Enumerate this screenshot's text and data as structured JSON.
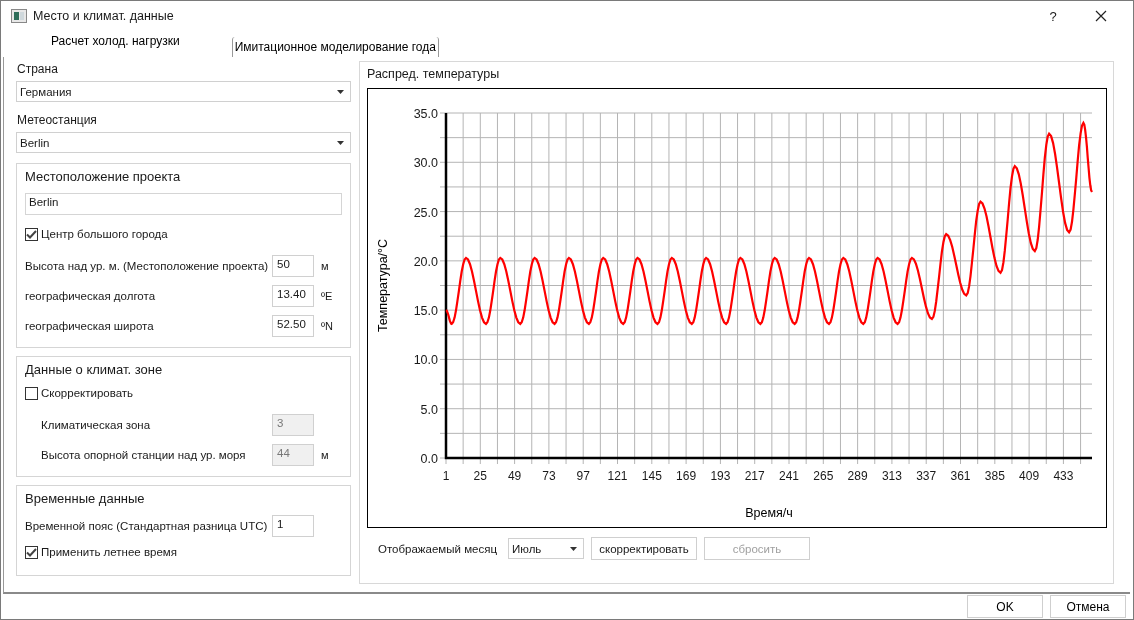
{
  "window": {
    "title": "Место и климат. данные",
    "help": "?"
  },
  "tabs": [
    {
      "label": "Расчет холод. нагрузки",
      "selected": true
    },
    {
      "label": "Имитационное моделирование года",
      "selected": false
    }
  ],
  "country": {
    "label": "Страна",
    "value": "Германия"
  },
  "station": {
    "label": "Метеостанция",
    "value": "Berlin"
  },
  "project_location": {
    "title": "Местоположение проекта",
    "name": "Berlin",
    "big_city": {
      "label": "Центр большого города",
      "checked": true
    },
    "fields": [
      {
        "label": "Высота над ур. м. (Местоположение проекта)",
        "value": "50",
        "unit": "м",
        "disabled": false
      },
      {
        "label": "географическая долгота",
        "value": "13.40",
        "unit": "ºE",
        "disabled": false
      },
      {
        "label": "географическая широта",
        "value": "52.50",
        "unit": "ºN",
        "disabled": false
      }
    ]
  },
  "climate_zone": {
    "title": "Данные о климат. зоне",
    "adjust": {
      "label": "Скорректировать",
      "checked": false
    },
    "fields": [
      {
        "label": "Климатическая зона",
        "value": "3",
        "disabled": true
      },
      {
        "label": "Высота опорной станции над ур. моря",
        "value": "44",
        "unit": "м",
        "disabled": true
      }
    ]
  },
  "time_data": {
    "title": "Временные данные",
    "fields": [
      {
        "label": "Временной пояс (Стандартная разница UTC)",
        "value": "1",
        "disabled": false
      }
    ],
    "dst": {
      "label": "Применить летнее время",
      "checked": true
    }
  },
  "chart_panel": {
    "title": "Распред. температуры",
    "chart_data": {
      "type": "line",
      "grid": true,
      "xlabel": "Время/ч",
      "ylabel": "Температура/°C",
      "xlim": [
        1,
        453
      ],
      "ylim": [
        0,
        35
      ],
      "xticks": [
        1,
        25,
        49,
        73,
        97,
        121,
        145,
        169,
        193,
        217,
        241,
        265,
        289,
        313,
        337,
        361,
        385,
        409,
        433
      ],
      "yticks": [
        {
          "value": 0,
          "label": "0.0"
        },
        {
          "value": 5,
          "label": "5.0"
        },
        {
          "value": 10,
          "label": "10.0"
        },
        {
          "value": 15,
          "label": "15.0"
        },
        {
          "value": 20,
          "label": "20.0"
        },
        {
          "value": 25,
          "label": "25.0"
        },
        {
          "value": 30,
          "label": "30.0"
        },
        {
          "value": 35,
          "label": "35.0"
        }
      ],
      "x": [
        1,
        5,
        15,
        29,
        39,
        53,
        63,
        77,
        87,
        101,
        111,
        125,
        135,
        149,
        159,
        173,
        183,
        197,
        207,
        221,
        231,
        245,
        255,
        269,
        279,
        293,
        303,
        317,
        327,
        341,
        351,
        365,
        375,
        389,
        399,
        413,
        423,
        437,
        447,
        453
      ],
      "series": [
        {
          "color": "#ff0000",
          "values": [
            15.0,
            13.6,
            20.3,
            13.6,
            20.3,
            13.6,
            20.3,
            13.6,
            20.3,
            13.6,
            20.3,
            13.6,
            20.3,
            13.6,
            20.3,
            13.6,
            20.3,
            13.6,
            20.3,
            13.6,
            20.3,
            13.6,
            20.3,
            13.6,
            20.3,
            13.6,
            20.3,
            13.6,
            20.3,
            14.1,
            22.7,
            16.5,
            26.0,
            18.8,
            29.6,
            21.0,
            32.9,
            22.9,
            34.0,
            27.0
          ]
        }
      ]
    },
    "month": {
      "label": "Отображаемый месяц",
      "value": "Июль"
    },
    "buttons": [
      {
        "label": "скорректировать",
        "disabled": false
      },
      {
        "label": "сбросить",
        "disabled": true
      }
    ]
  },
  "footer_buttons": [
    {
      "label": "OK"
    },
    {
      "label": "Отмена"
    }
  ]
}
